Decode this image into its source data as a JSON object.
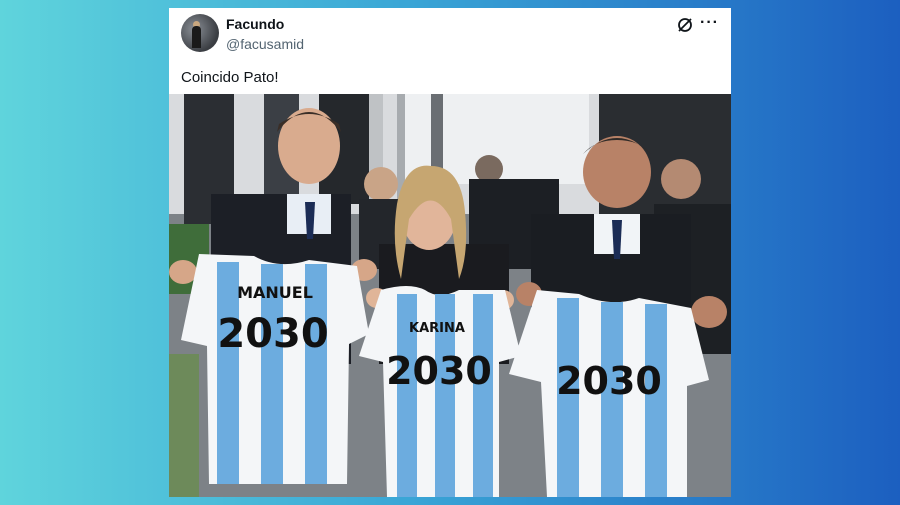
{
  "post": {
    "author_name": "Facundo",
    "author_handle": "@facusamid",
    "text": "Coincido Pato!"
  },
  "icons": {
    "x_icon": "x-logo-icon",
    "more_icon": "more-options-icon",
    "more_glyph": "···"
  },
  "photo": {
    "jerseys": [
      {
        "name": "MANUEL",
        "number": "2030"
      },
      {
        "name": "KARINA",
        "number": "2030"
      },
      {
        "name": "",
        "number": "2030"
      }
    ]
  },
  "colors": {
    "jersey_blue": "#6cacdf",
    "jersey_white": "#f4f6f8"
  }
}
